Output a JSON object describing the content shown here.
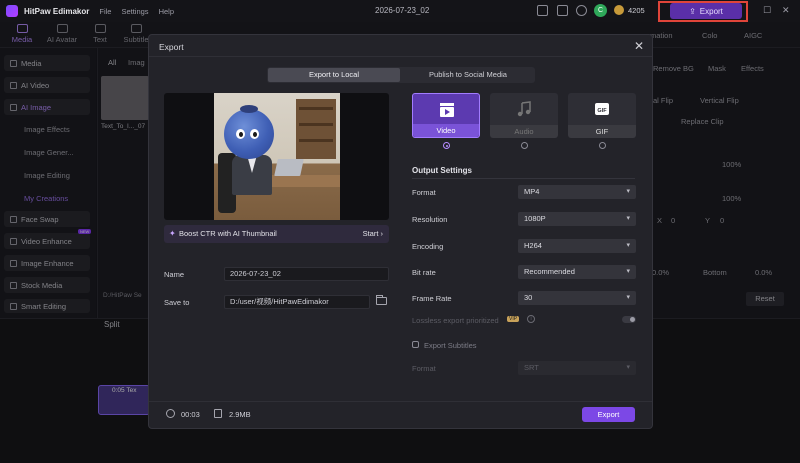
{
  "app": {
    "title": "HitPaw Edimakor",
    "menu": [
      "File",
      "Settings",
      "Help"
    ],
    "doc_title": "2026-07-23_02",
    "avatar_letter": "C",
    "coins": "4205",
    "export_label": "Export"
  },
  "toolbar": {
    "tabs": [
      "Media",
      "AI Avatar",
      "Text",
      "Subtitle"
    ],
    "right_tabs": [
      "mation",
      "Colo",
      "AIGC"
    ]
  },
  "sidebar": {
    "items": [
      "Media",
      "AI Video",
      "AI Image",
      "Face Swap",
      "Video Enhance",
      "Image Enhance",
      "Stock Media",
      "Smart Editing"
    ],
    "sub_items": [
      "Image Effects",
      "Image Gener...",
      "Image Editing",
      "My Creations"
    ],
    "new_badge": "NEW"
  },
  "media_panel": {
    "tabs": [
      "All",
      "Imag"
    ],
    "thumb_label": "Text_To_I..._07",
    "path": "D:/HitPaw Se"
  },
  "right_panel": {
    "items": [
      "Remove BG",
      "Mask",
      "Effects",
      "al Flip",
      "Vertical Flip",
      "Replace Clip",
      "100%",
      "100%",
      "X",
      "0",
      "Y",
      "0",
      "0.0%",
      "Bottom",
      "0.0%"
    ],
    "reset_label": "Reset"
  },
  "timeline": {
    "split_label": "Split",
    "clip_label": "0:05 Tex"
  },
  "modal": {
    "title": "Export",
    "tabs": [
      "Export to Local",
      "Publish to Social Media"
    ],
    "ctr_text": "Boost CTR with AI Thumbnail",
    "ctr_action": "Start",
    "name_label": "Name",
    "name_value": "2026-07-23_02",
    "saveto_label": "Save to",
    "saveto_value": "D:/user/视频/HitPawEdimakor",
    "formats": [
      "Video",
      "Audio",
      "GIF"
    ],
    "output_settings_title": "Output Settings",
    "options": [
      {
        "label": "Format",
        "value": "MP4"
      },
      {
        "label": "Resolution",
        "value": "1080P"
      },
      {
        "label": "Encoding",
        "value": "H264"
      },
      {
        "label": "Bit rate",
        "value": "Recommended"
      },
      {
        "label": "Frame Rate",
        "value": "30"
      }
    ],
    "lossless_label": "Lossless export prioritized",
    "vip_badge": "VIP",
    "export_subtitles_label": "Export Subtitles",
    "subtitle_format_label": "Format",
    "subtitle_format_value": "SRT",
    "duration": "00:03",
    "file_size": "2.9MB",
    "export_button": "Export"
  },
  "colors": {
    "accent": "#7c48e6",
    "highlight": "#e0453a",
    "modal_bg": "#232329"
  }
}
